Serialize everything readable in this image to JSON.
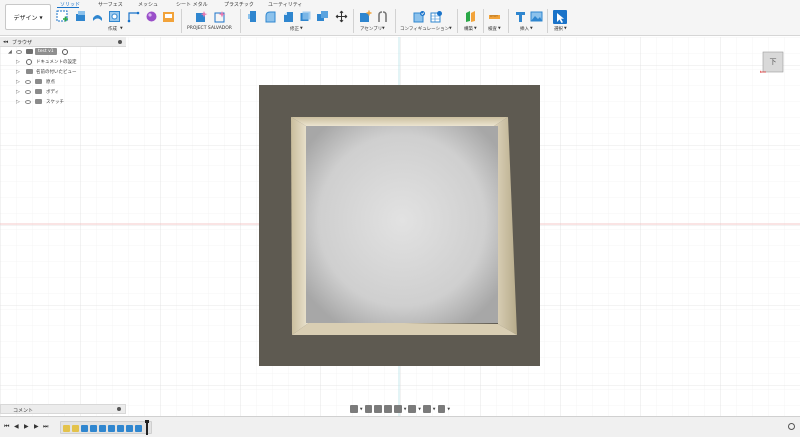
{
  "toolbar": {
    "workspace_label": "デザイン",
    "tabs": [
      {
        "label": "ソリッド",
        "active": true
      },
      {
        "label": "サーフェス",
        "active": false
      },
      {
        "label": "メッシュ",
        "active": false
      },
      {
        "label": "シート メタル",
        "active": false
      },
      {
        "label": "プラスチック",
        "active": false
      },
      {
        "label": "ユーティリティ",
        "active": false
      }
    ],
    "groups": [
      {
        "label": "作成"
      },
      {
        "label": "PROJECT SALVADOR"
      },
      {
        "label": "修正"
      },
      {
        "label": "アセンブリ"
      },
      {
        "label": "コンフィギュレーション"
      },
      {
        "label": "構築"
      },
      {
        "label": "検査"
      },
      {
        "label": "挿入"
      },
      {
        "label": "選択"
      }
    ],
    "accent_color": "#1a73c9"
  },
  "browser": {
    "title": "ブラウザ",
    "root": {
      "label": "test v1"
    },
    "items": [
      {
        "label": "ドキュメントの設定",
        "icon": "gear-icon"
      },
      {
        "label": "名前の付いたビュー",
        "icon": "folder-icon"
      },
      {
        "label": "原点",
        "icon": "folder-icon"
      },
      {
        "label": "ボディ",
        "icon": "folder-icon"
      },
      {
        "label": "スケッチ",
        "icon": "folder-icon"
      }
    ]
  },
  "viewcube": {
    "face_label": "下",
    "axis_label": "X"
  },
  "comments": {
    "label": "コメント"
  },
  "navbar": {
    "icons": [
      "orbit-icon",
      "look-at-icon",
      "pan-icon",
      "zoom-icon",
      "zoom-window-icon",
      "display-settings-icon",
      "grid-icon",
      "viewports-icon"
    ]
  },
  "timeline": {
    "features": [
      {
        "icon": "sketch-icon",
        "color": "#e3c24b"
      },
      {
        "icon": "sketch-icon",
        "color": "#e3c24b"
      },
      {
        "icon": "extrude-icon",
        "color": "#2f86cf"
      },
      {
        "icon": "extrude-icon",
        "color": "#2f86cf"
      },
      {
        "icon": "extrude-icon",
        "color": "#2f86cf"
      },
      {
        "icon": "extrude-icon",
        "color": "#2f86cf"
      },
      {
        "icon": "extrude-icon",
        "color": "#2f86cf"
      },
      {
        "icon": "extrude-icon",
        "color": "#2f86cf"
      },
      {
        "icon": "extrude-icon",
        "color": "#2f86cf"
      }
    ]
  },
  "model": {
    "outer_color": "#5e5a51",
    "frame_color": "#d8cdb4",
    "inner_color": "#d9d9d9"
  }
}
